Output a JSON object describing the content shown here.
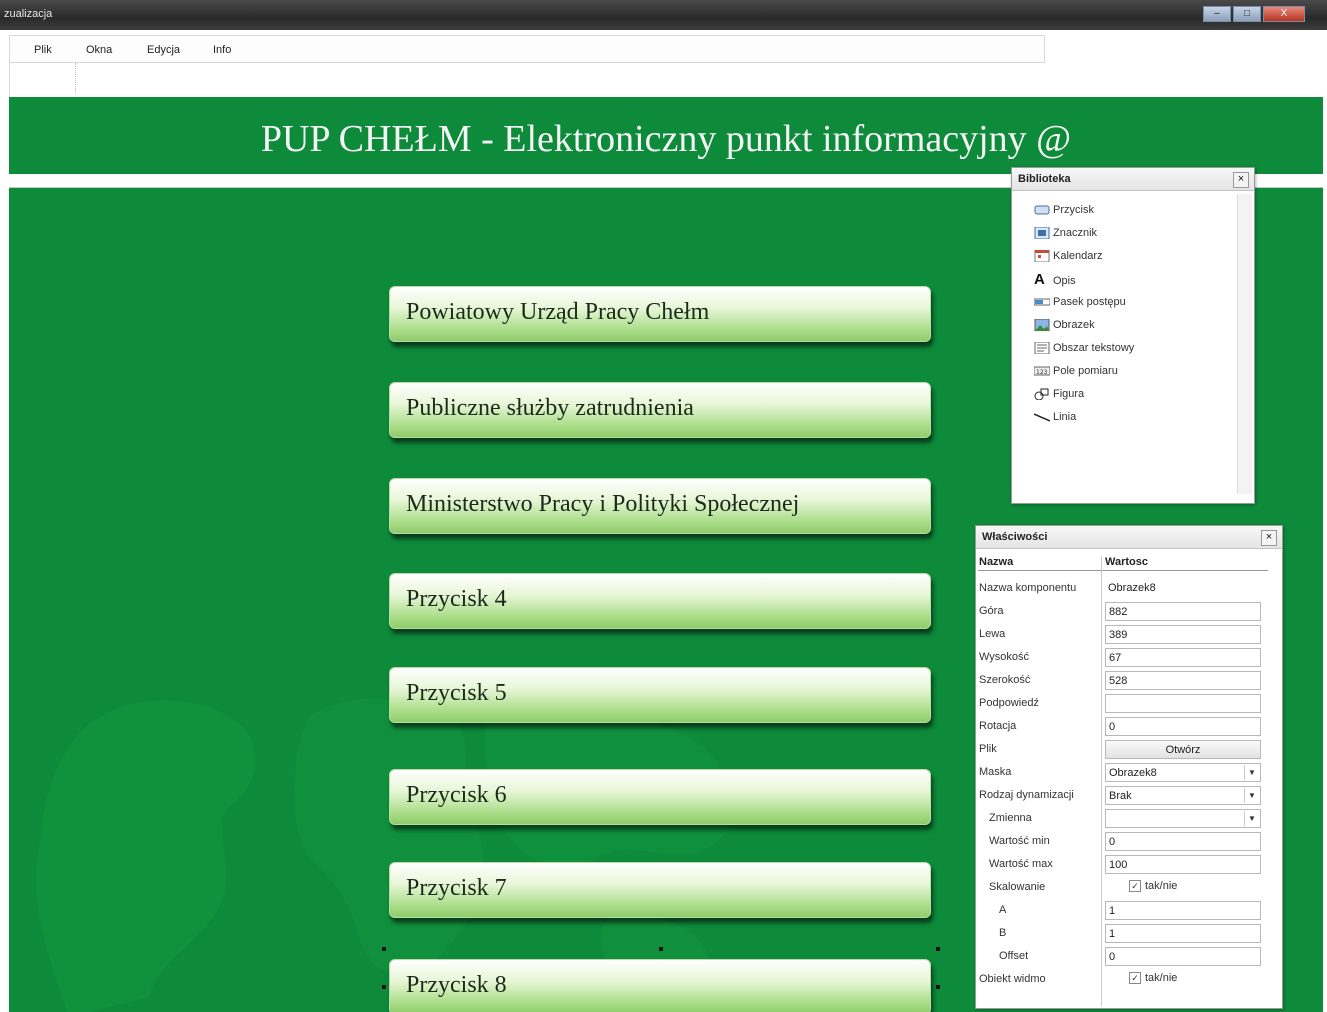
{
  "window": {
    "title": "zualizacja",
    "controls": {
      "minimize": "–",
      "maximize": "□",
      "close": "X"
    }
  },
  "menu": {
    "items": [
      {
        "label": "Plik"
      },
      {
        "label": "Okna"
      },
      {
        "label": "Edycja"
      },
      {
        "label": "Info"
      }
    ]
  },
  "canvas": {
    "background_color": "#0d8a3a",
    "banner_title": "PUP CHEŁM - Elektroniczny punkt informacyjny @",
    "buttons": [
      {
        "label": "Powiatowy Urząd Pracy Chełm"
      },
      {
        "label": "Publiczne służby zatrudnienia"
      },
      {
        "label": "Ministerstwo Pracy i Polityki Społecznej"
      },
      {
        "label": "Przycisk 4"
      },
      {
        "label": "Przycisk 5"
      },
      {
        "label": "Przycisk 6"
      },
      {
        "label": "Przycisk 7"
      },
      {
        "label": "Przycisk 8"
      }
    ]
  },
  "library": {
    "title": "Biblioteka",
    "close": "×",
    "items": [
      {
        "label": "Przycisk",
        "icon": "button-icon"
      },
      {
        "label": "Znacznik",
        "icon": "marker-icon"
      },
      {
        "label": "Kalendarz",
        "icon": "calendar-icon"
      },
      {
        "label": "Opis",
        "icon": "text-a-icon"
      },
      {
        "label": "Pasek postępu",
        "icon": "progressbar-icon"
      },
      {
        "label": "Obrazek",
        "icon": "image-icon"
      },
      {
        "label": "Obszar tekstowy",
        "icon": "textarea-icon"
      },
      {
        "label": "Pole pomiaru",
        "icon": "measure-icon"
      },
      {
        "label": "Figura",
        "icon": "shape-icon"
      },
      {
        "label": "Linia",
        "icon": "line-icon"
      }
    ]
  },
  "properties": {
    "title": "Właściwości",
    "close": "×",
    "col_name": "Nazwa",
    "col_value": "Wartosc",
    "rows": {
      "component_name": {
        "name": "Nazwa komponentu",
        "value": "Obrazek8"
      },
      "top": {
        "name": "Góra",
        "value": "882"
      },
      "left": {
        "name": "Lewa",
        "value": "389"
      },
      "height": {
        "name": "Wysokość",
        "value": "67"
      },
      "width": {
        "name": "Szerokość",
        "value": "528"
      },
      "tooltip": {
        "name": "Podpowiedź",
        "value": ""
      },
      "rotation": {
        "name": "Rotacja",
        "value": "0"
      },
      "file": {
        "name": "Plik",
        "value": "Otwórz"
      },
      "mask": {
        "name": "Maska",
        "value": "Obrazek8"
      },
      "dynamics_type": {
        "name": "Rodzaj dynamizacji",
        "value": "Brak"
      },
      "variable": {
        "name": "Zmienna",
        "value": ""
      },
      "value_min": {
        "name": "Wartość min",
        "value": "0"
      },
      "value_max": {
        "name": "Wartość max",
        "value": "100"
      },
      "scaling": {
        "name": "Skalowanie",
        "value": "tak/nie"
      },
      "a": {
        "name": "A",
        "value": "1"
      },
      "b": {
        "name": "B",
        "value": "1"
      },
      "offset": {
        "name": "Offset",
        "value": "0"
      },
      "ghost_object": {
        "name": "Obiekt widmo",
        "value": "tak/nie"
      }
    }
  }
}
